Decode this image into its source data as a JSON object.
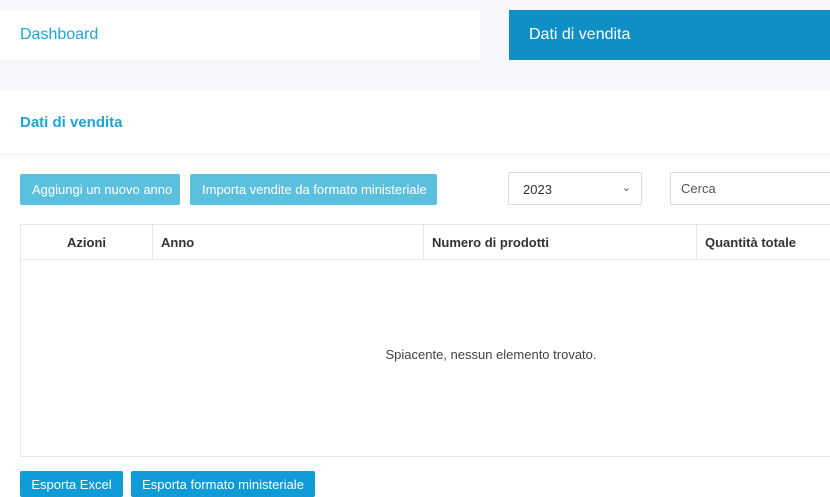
{
  "tabs": {
    "dashboard_label": "Dashboard",
    "active_label": "Dati di vendita"
  },
  "page": {
    "title": "Dati di vendita"
  },
  "toolbar": {
    "add_year_label": "Aggiungi un nuovo anno",
    "import_label": "Importa vendite da formato ministeriale",
    "year_selected": "2023",
    "search_placeholder": "Cerca"
  },
  "table": {
    "columns": [
      "Azioni",
      "Anno",
      "Numero di prodotti",
      "Quantità totale"
    ],
    "empty_message": "Spiacente, nessun elemento trovato."
  },
  "footer": {
    "export_excel_label": "Esporta Excel",
    "export_ministeriale_label": "Esporta formato ministeriale"
  },
  "colors": {
    "accent": "#1fa4d6",
    "active_tab": "#0f8fc4",
    "light_button": "#5bc0de",
    "export_button": "#0f9bd7"
  },
  "icons": {
    "select_caret": "chevron-down-icon"
  }
}
